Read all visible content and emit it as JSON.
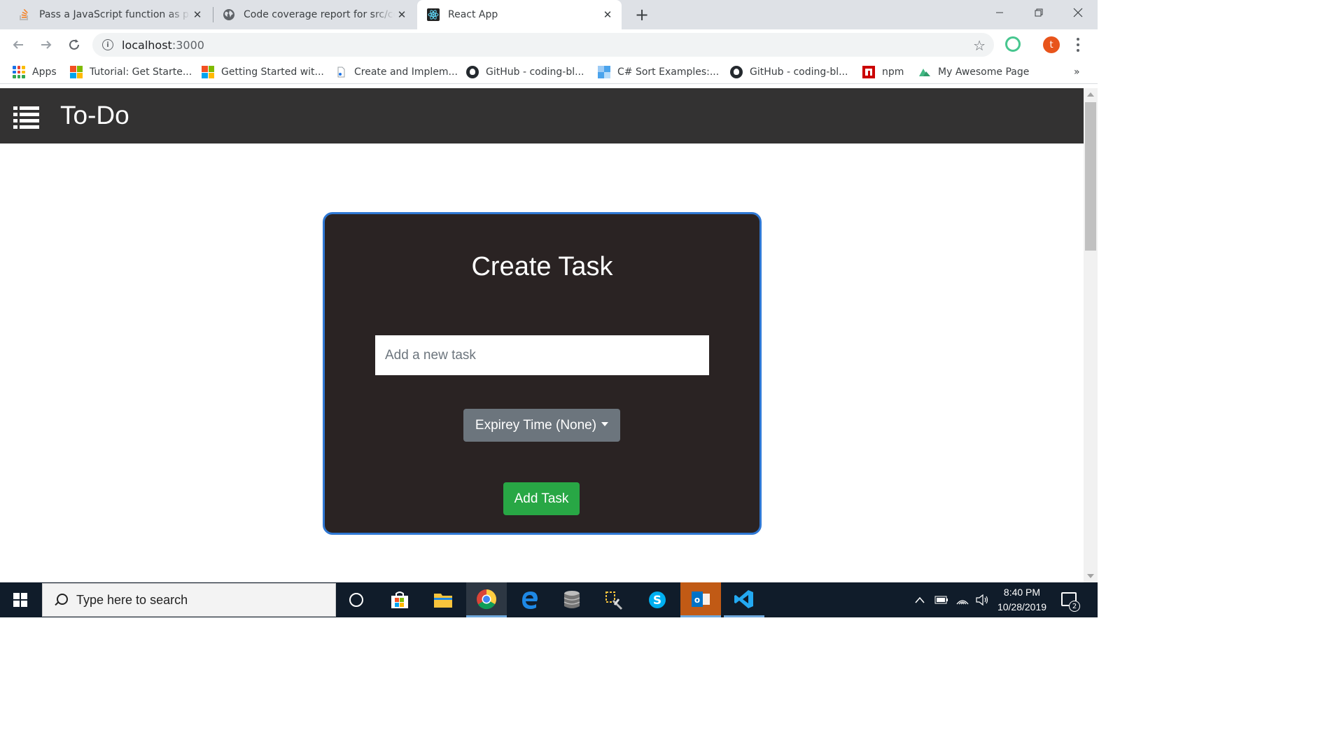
{
  "browser": {
    "tabs": [
      {
        "title": "Pass a JavaScript function as para",
        "favicon": "stackoverflow-icon",
        "active": false
      },
      {
        "title": "Code coverage report for src/con",
        "favicon": "globe-icon",
        "active": false
      },
      {
        "title": "React App",
        "favicon": "react-icon",
        "active": true
      }
    ],
    "new_tab_symbol": "+",
    "address": {
      "host": "localhost",
      "port": ":3000"
    },
    "profile_initial": "t",
    "bookmarks": [
      {
        "label": "Apps",
        "icon": "apps-grid-icon"
      },
      {
        "label": "Tutorial: Get Starte...",
        "icon": "microsoft-icon"
      },
      {
        "label": "Getting Started wit...",
        "icon": "microsoft-icon"
      },
      {
        "label": "Create and Implem...",
        "icon": "page-icon"
      },
      {
        "label": "GitHub - coding-bl...",
        "icon": "github-icon"
      },
      {
        "label": "C# Sort Examples:...",
        "icon": "dotnetperls-icon"
      },
      {
        "label": "GitHub - coding-bl...",
        "icon": "github-icon"
      },
      {
        "label": "npm",
        "icon": "npm-icon"
      },
      {
        "label": "My Awesome Page",
        "icon": "nuxt-icon"
      }
    ],
    "bookmarks_overflow": "»"
  },
  "app": {
    "brand": "To-Do",
    "card_title": "Create Task",
    "task_placeholder": "Add a new task",
    "expiry_label": "Expirey Time (None)",
    "add_label": "Add Task"
  },
  "taskbar": {
    "search_placeholder": "Type here to search",
    "time": "8:40 PM",
    "date": "10/28/2019",
    "notification_count": "2"
  },
  "colors": {
    "nav_bg": "#333232",
    "card_bg": "#2a2323",
    "card_border": "#2f78d4",
    "dropdown_bg": "#6c757d",
    "add_button_bg": "#28a745"
  }
}
